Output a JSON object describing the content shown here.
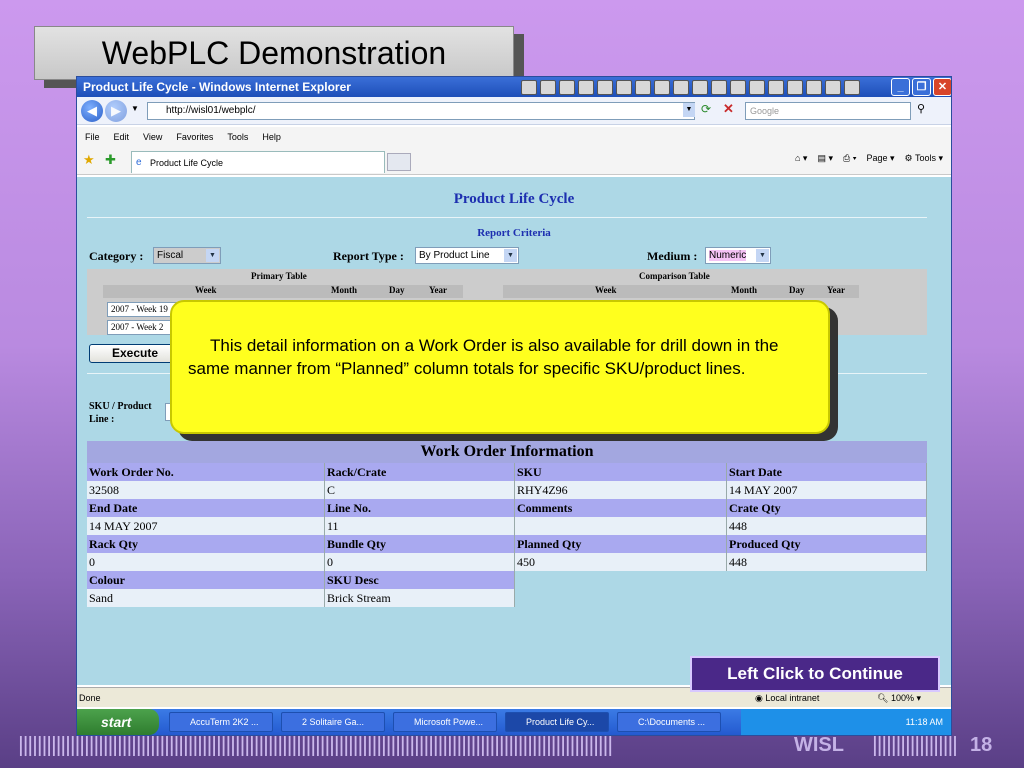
{
  "slide": {
    "title": "WebPLC Demonstration",
    "continue_label": "Left Click to Continue",
    "footer_brand": "WISL",
    "slide_number": "18",
    "callout": "This detail information on a Work Order is also available for drill down in the same manner from “Planned” column totals for specific SKU/product lines."
  },
  "browser": {
    "title": "Product Life Cycle - Windows Internet Explorer",
    "address": "http://wisl01/webplc/",
    "search_placeholder": "Google",
    "menu": [
      "File",
      "Edit",
      "View",
      "Favorites",
      "Tools",
      "Help"
    ],
    "tab_title": "Product Life Cycle",
    "page_label": "Page",
    "tools_label": "Tools",
    "status_left": "Done",
    "zone": "Local intranet",
    "zoom": "100%"
  },
  "page": {
    "heading": "Product Life Cycle",
    "criteria_label": "Report Criteria",
    "category_label": "Category :",
    "category_value": "Fiscal",
    "report_type_label": "Report Type :",
    "report_type_value": "By Product Line",
    "medium_label": "Medium :",
    "medium_value": "Numeric",
    "primary_table_label": "Primary Table",
    "comparison_table_label": "Comparison Table",
    "col_week": "Week",
    "col_month": "Month",
    "col_day": "Day",
    "col_year": "Year",
    "week_from": "2007 - Week 19",
    "week_to": "2007 - Week 2",
    "execute_label": "Execute",
    "sku_label_1": "SKU / Product",
    "sku_label_2": "Line :"
  },
  "work_order": {
    "title": "Work Order Information",
    "labels": {
      "wo_no": "Work Order No.",
      "rack_crate": "Rack/Crate",
      "sku": "SKU",
      "start_date": "Start Date",
      "end_date": "End Date",
      "line_no": "Line No.",
      "comments": "Comments",
      "crate_qty": "Crate Qty",
      "rack_qty": "Rack Qty",
      "bundle_qty": "Bundle Qty",
      "planned_qty": "Planned Qty",
      "produced_qty": "Produced Qty",
      "colour": "Colour",
      "sku_desc": "SKU Desc"
    },
    "values": {
      "wo_no": "32508",
      "rack_crate": "C",
      "sku": "RHY4Z96",
      "start_date": "14 MAY 2007",
      "end_date": "14 MAY 2007",
      "line_no": "11",
      "comments": "",
      "crate_qty": "448",
      "rack_qty": "0",
      "bundle_qty": "0",
      "planned_qty": "450",
      "produced_qty": "448",
      "colour": "Sand",
      "sku_desc": "Brick Stream"
    }
  },
  "taskbar": {
    "start": "start",
    "tasks": [
      "AccuTerm 2K2 ...",
      "2 Solitaire Ga...",
      "Microsoft Powe...",
      "Product Life Cy...",
      "C:\\Documents ..."
    ],
    "clock": "11:18 AM"
  }
}
